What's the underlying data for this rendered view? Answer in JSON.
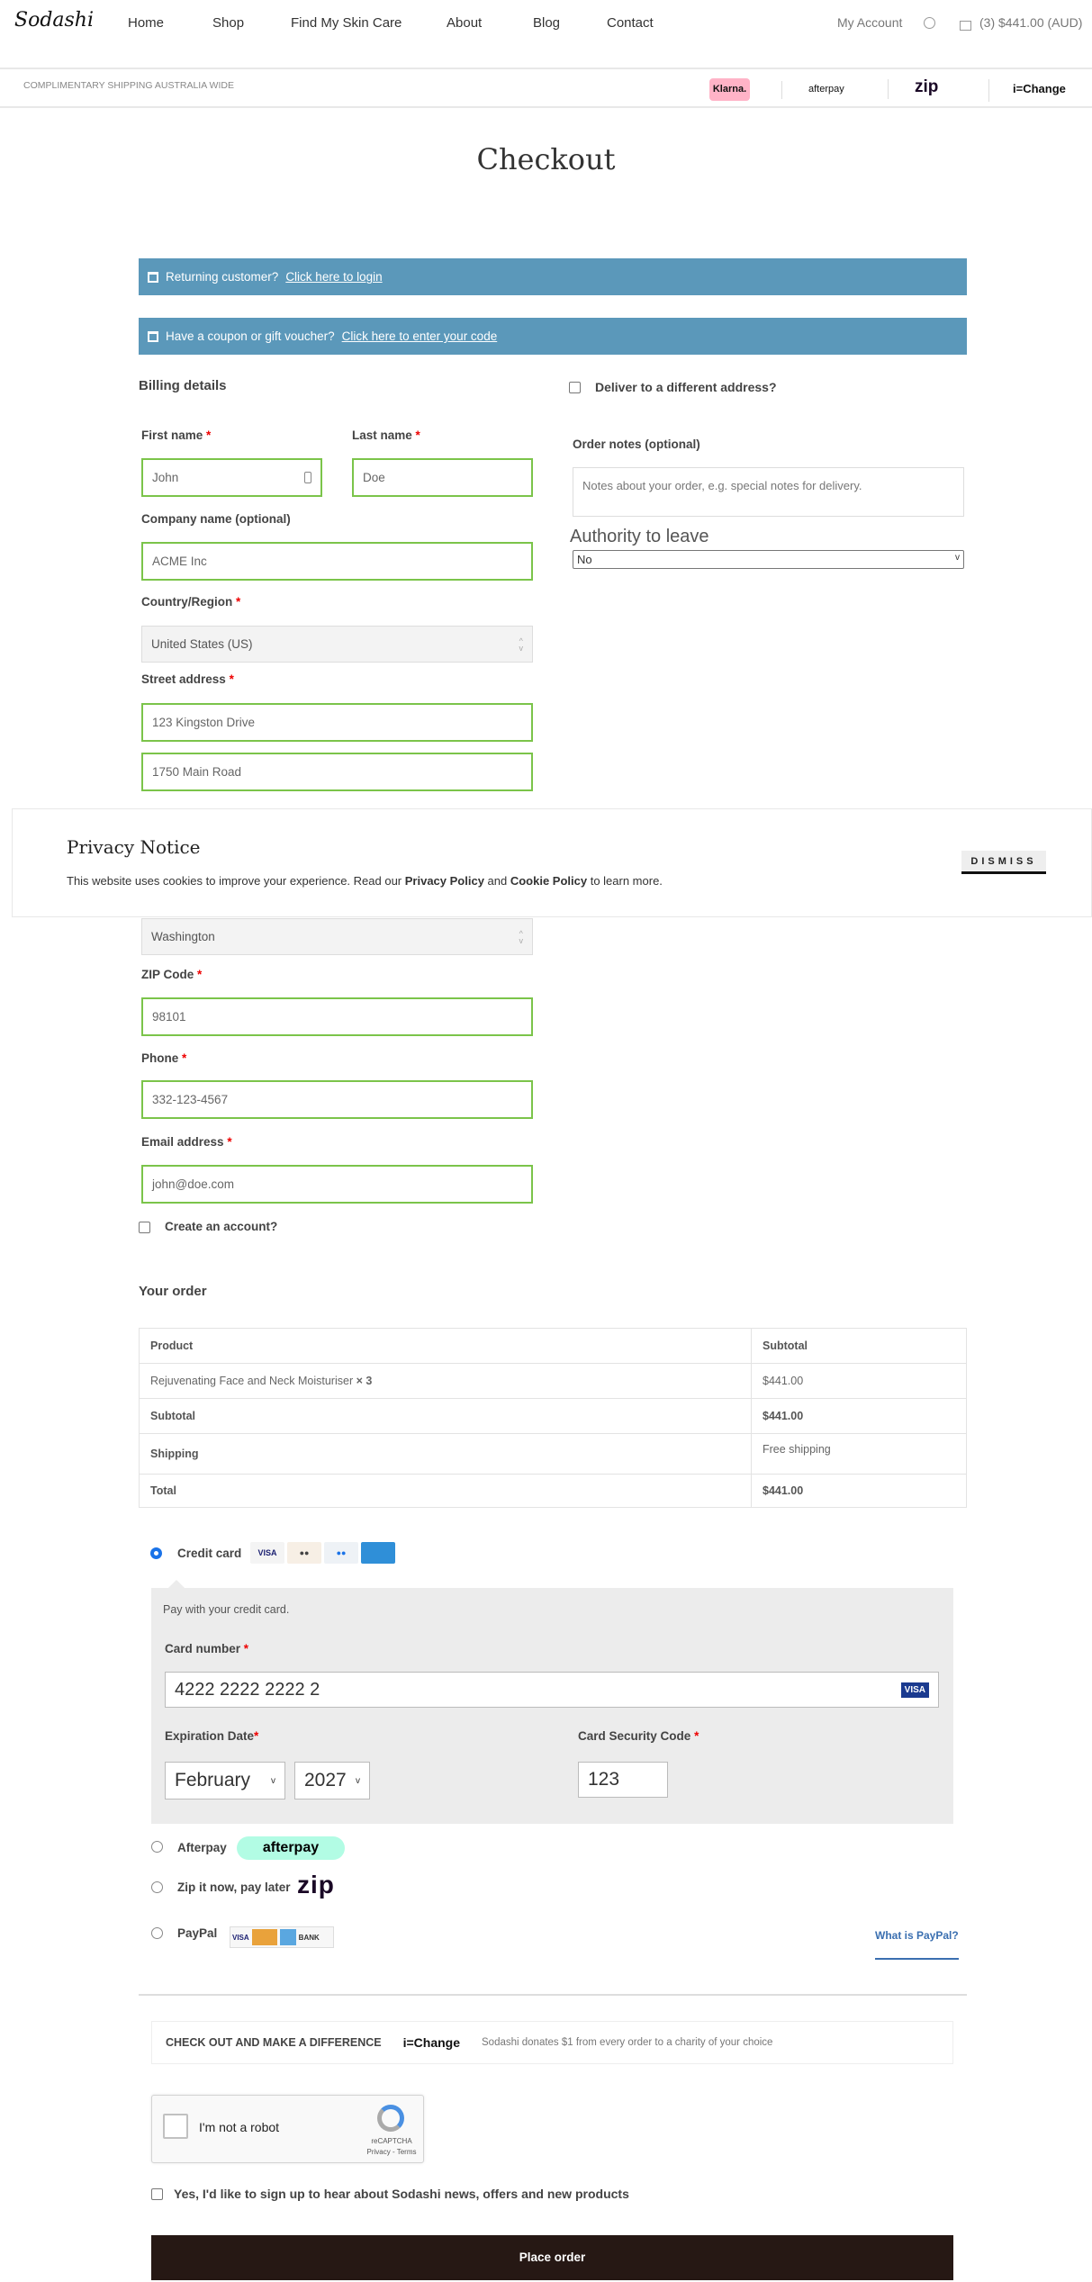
{
  "header": {
    "logo": "Sodashi",
    "nav": [
      "Home",
      "Shop",
      "Find My Skin Care",
      "About",
      "Blog",
      "Contact"
    ],
    "my_account": "My Account",
    "cart": "(3) $441.00 (AUD)"
  },
  "subheader": {
    "shipping": "COMPLIMENTARY SHIPPING AUSTRALIA WIDE",
    "partners": [
      "Klarna.",
      "afterpay",
      "zip",
      "i=Change"
    ]
  },
  "page_title": "Checkout",
  "notices": {
    "returning": "Returning customer?",
    "login_link": "Click here to login",
    "coupon": "Have a coupon or gift voucher?",
    "coupon_link": "Click here to enter your code"
  },
  "billing": {
    "title": "Billing details",
    "first_name_label": "First name",
    "first_name": "John",
    "last_name_label": "Last name",
    "last_name": "Doe",
    "company_label": "Company name (optional)",
    "company": "ACME Inc",
    "country_label": "Country/Region",
    "country": "United States (US)",
    "street_label": "Street address",
    "street1": "123 Kingston Drive",
    "street2": "1750 Main Road",
    "state": "Washington",
    "zip_label": "ZIP Code",
    "zip": "98101",
    "phone_label": "Phone",
    "phone": "332-123-4567",
    "email_label": "Email address",
    "email": "john@doe.com",
    "create_account": "Create an account?"
  },
  "shipping": {
    "deliver_different": "Deliver to a different address?",
    "notes_label": "Order notes (optional)",
    "notes_placeholder": "Notes about your order, e.g. special notes for delivery.",
    "authority_label": "Authority to leave",
    "authority_value": "No"
  },
  "privacy": {
    "title": "Privacy Notice",
    "text1": "This website uses cookies to improve your experience. Read our ",
    "privacy_link": "Privacy Policy",
    "and": " and ",
    "cookie_link": "Cookie Policy",
    "text2": " to learn more.",
    "dismiss": "DISMISS"
  },
  "order": {
    "title": "Your order",
    "headers": [
      "Product",
      "Subtotal"
    ],
    "item": "Rejuvenating Face and Neck Moisturiser",
    "qty": "× 3",
    "item_total": "$441.00",
    "subtotal_label": "Subtotal",
    "subtotal": "$441.00",
    "shipping_label": "Shipping",
    "shipping": "Free shipping",
    "total_label": "Total",
    "total": "$441.00"
  },
  "payment": {
    "credit_card": "Credit card",
    "pay_with": "Pay with your credit card.",
    "card_number_label": "Card number",
    "card_number": "4222 2222 2222 2",
    "exp_label": "Expiration Date",
    "exp_month": "February",
    "exp_year": "2027",
    "csc_label": "Card Security Code",
    "csc": "123",
    "afterpay": "Afterpay",
    "afterpay_logo": "afterpay",
    "zip": "Zip it now, pay later",
    "zip_logo": "zip",
    "paypal": "PayPal",
    "what_paypal": "What is PayPal?",
    "paypal_bank": "BANK",
    "visa": "VISA"
  },
  "ichange": {
    "heading": "CHECK OUT AND MAKE A DIFFERENCE",
    "logo": "i=Change",
    "text": "Sodashi donates $1 from every order to a charity of your choice"
  },
  "recaptcha": {
    "label": "I'm not a robot",
    "brand": "reCAPTCHA",
    "links": "Privacy - Terms"
  },
  "newsletter": "Yes, I'd like to sign up to hear about Sodashi news, offers and new products",
  "place_order": "Place order",
  "colors": {
    "notice_bar": "#5b98ba",
    "valid_border": "#7bc44a",
    "place_order_bg": "#261814",
    "required": "#e00000"
  }
}
